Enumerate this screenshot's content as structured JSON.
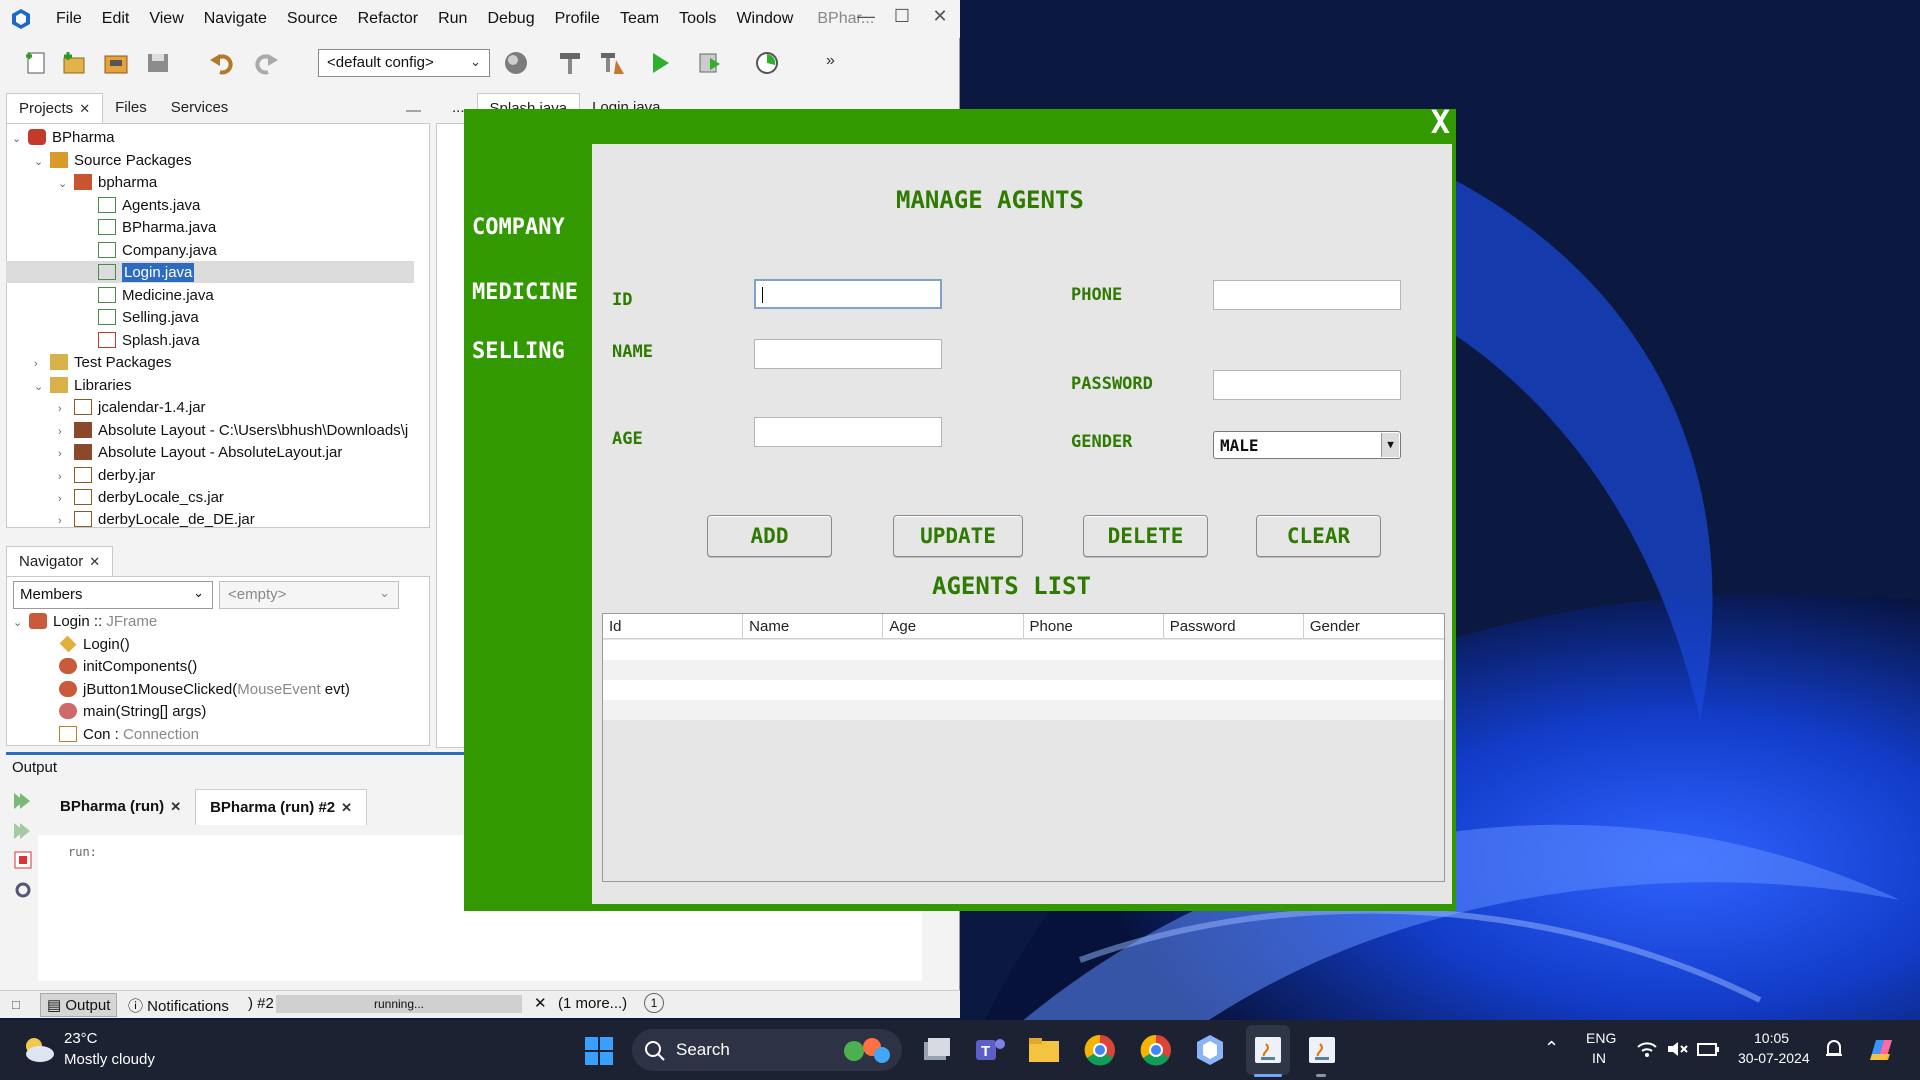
{
  "ide": {
    "menu": [
      "File",
      "Edit",
      "View",
      "Navigate",
      "Source",
      "Refactor",
      "Run",
      "Debug",
      "Profile",
      "Team",
      "Tools",
      "Window"
    ],
    "title": "BPhar...",
    "config": "<default config>",
    "projects_tabs": [
      "Projects",
      "Files",
      "Services"
    ],
    "editor_tabs": [
      "Splash.java",
      "Login.java"
    ],
    "tree": [
      {
        "label": "BPharma",
        "level": 0,
        "expanded": true
      },
      {
        "label": "Source Packages",
        "level": 1,
        "expanded": true
      },
      {
        "label": "bpharma",
        "level": 2,
        "expanded": true
      },
      {
        "label": "Agents.java",
        "level": 3
      },
      {
        "label": "BPharma.java",
        "level": 3
      },
      {
        "label": "Company.java",
        "level": 3
      },
      {
        "label": "Login.java",
        "level": 3,
        "selected": true
      },
      {
        "label": "Medicine.java",
        "level": 3
      },
      {
        "label": "Selling.java",
        "level": 3
      },
      {
        "label": "Splash.java",
        "level": 3
      },
      {
        "label": "Test Packages",
        "level": 1,
        "expanded": false
      },
      {
        "label": "Libraries",
        "level": 1,
        "expanded": true
      },
      {
        "label": "jcalendar-1.4.jar",
        "level": 2
      },
      {
        "label": "Absolute Layout - C:\\Users\\bhush\\Downloads\\j",
        "level": 2
      },
      {
        "label": "Absolute Layout - AbsoluteLayout.jar",
        "level": 2
      },
      {
        "label": "derby.jar",
        "level": 2
      },
      {
        "label": "derbyLocale_cs.jar",
        "level": 2
      },
      {
        "label": "derbyLocale_de_DE.jar",
        "level": 2
      }
    ],
    "navigator": {
      "tab": "Navigator",
      "members": "Members",
      "empty": "<empty>",
      "items": [
        {
          "label": "Login :: ",
          "type": "JFrame"
        },
        {
          "label": "Login()",
          "type": ""
        },
        {
          "label": "initComponents()",
          "type": ""
        },
        {
          "label": "jButton1MouseClicked(",
          "type": "MouseEvent",
          "suffix": " evt)"
        },
        {
          "label": "main(String[] args)",
          "type": ""
        },
        {
          "label": "Con : ",
          "type": "Connection"
        }
      ]
    },
    "output": {
      "title": "Output",
      "tabs": [
        "BPharma (run)",
        "BPharma (run) #2"
      ],
      "text": "run:"
    },
    "status": {
      "output": "Output",
      "notifications": "Notifications",
      "run_ref": ") #2",
      "progress": "running...",
      "more": "(1 more...)",
      "badge": "1"
    }
  },
  "agents": {
    "close": "X",
    "nav": [
      "COMPANY",
      "MEDICINE",
      "SELLING"
    ],
    "title": "MANAGE AGENTS",
    "labels": {
      "id": "ID",
      "name": "NAME",
      "age": "AGE",
      "phone": "PHONE",
      "password": "PASSWORD",
      "gender": "GENDER"
    },
    "gender_value": "MALE",
    "buttons": [
      "ADD",
      "UPDATE",
      "DELETE",
      "CLEAR"
    ],
    "list_title": "AGENTS LIST",
    "columns": [
      "Id",
      "Name",
      "Age",
      "Phone",
      "Password",
      "Gender"
    ]
  },
  "taskbar": {
    "temp": "23°C",
    "weather": "Mostly cloudy",
    "search": "Search",
    "lang": "ENG",
    "region": "IN",
    "time": "10:05",
    "date": "30-07-2024"
  }
}
